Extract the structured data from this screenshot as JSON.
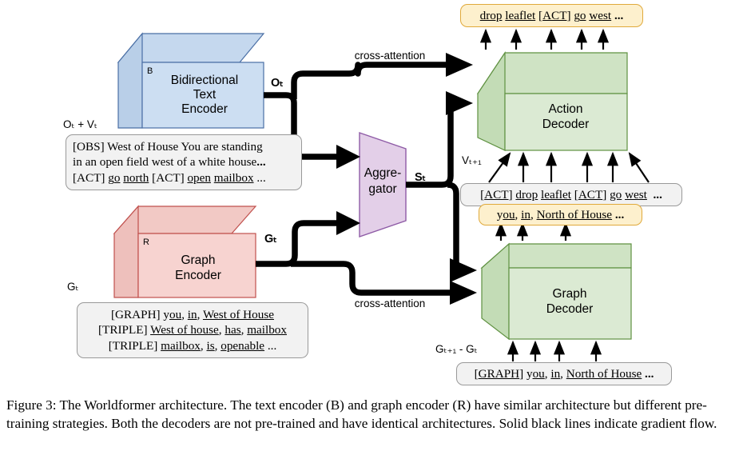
{
  "figure": {
    "caption": "Figure 3: The Worldformer architecture. The text encoder (B) and graph encoder (R) have similar architecture but different pre-training strategies.  Both the decoders are not pre-trained and have identical architectures. Solid black lines indicate gradient flow."
  },
  "colors": {
    "text_encoder_fill": "#ccdef2",
    "text_encoder_side": "#b9cfe8",
    "text_encoder_top": "#c5d8ee",
    "text_encoder_stroke": "#4a6fa5",
    "graph_encoder_fill": "#f7d3d0",
    "graph_encoder_side": "#eec0bc",
    "graph_encoder_top": "#f2c9c5",
    "graph_encoder_stroke": "#c0504d",
    "aggregator_fill": "#e3cfe8",
    "aggregator_stroke": "#8e5ba6",
    "decoder_fill": "#dbead3",
    "decoder_side": "#c3dcb6",
    "decoder_top": "#cfe3c4",
    "decoder_stroke": "#5f9141",
    "sequence_grey_fill": "#f2f2f2",
    "sequence_grey_stroke": "#999999",
    "sequence_yellow_fill": "#fdf0cd",
    "sequence_yellow_stroke": "#e0a93b",
    "flow_line": "#000000"
  },
  "nodes": {
    "text_encoder": {
      "title_lines": [
        "Bidirectional",
        "Text",
        "Encoder"
      ],
      "corner_tag": "B",
      "input_label": "Oₜ + Vₜ",
      "output_label": "Oₜ"
    },
    "graph_encoder": {
      "title_lines": [
        "Graph",
        "Encoder"
      ],
      "corner_tag": "R",
      "input_label": "Gₜ",
      "output_label": "Gₜ"
    },
    "aggregator": {
      "title_lines": [
        "Aggre-",
        "gator"
      ],
      "output_label": "Sₜ"
    },
    "action_decoder": {
      "title_lines": [
        "Action",
        "Decoder"
      ],
      "input_label": "Vₜ₊₁"
    },
    "graph_decoder": {
      "title_lines": [
        "Graph",
        "Decoder"
      ],
      "input_label": "Gₜ₊₁ - Gₜ"
    }
  },
  "edges": {
    "cross_attention_top": "cross-attention",
    "cross_attention_bottom": "cross-attention"
  },
  "sequences": {
    "text_encoder_input": {
      "style": "grey",
      "lines": [
        "[OBS] West of House You are standing",
        "in an open field west of a white house...",
        "[ACT] go north [ACT] open mailbox ..."
      ]
    },
    "graph_encoder_input": {
      "style": "grey",
      "lines": [
        "[GRAPH] you, in, West of House",
        "[TRIPLE] West of house, has, mailbox",
        "[TRIPLE] mailbox, is, openable ..."
      ]
    },
    "action_decoder_output": {
      "style": "yellow",
      "lines": [
        "drop leaflet [ACT] go west ..."
      ]
    },
    "action_decoder_input": {
      "style": "grey",
      "lines": [
        "[ACT] drop leaflet [ACT] go west  ..."
      ]
    },
    "graph_decoder_output": {
      "style": "yellow",
      "lines": [
        "you, in, North of House ..."
      ]
    },
    "graph_decoder_input": {
      "style": "grey",
      "lines": [
        "[GRAPH] you, in, North of House ..."
      ]
    }
  }
}
